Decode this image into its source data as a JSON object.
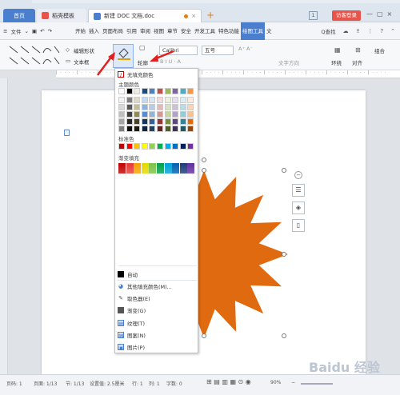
{
  "titlebar": {
    "tabs": [
      {
        "label": "首页"
      },
      {
        "label": "稻壳模板"
      },
      {
        "label": "新建 DOC 文档.doc"
      }
    ],
    "page_number_badge": "1",
    "login_label": "访客登录"
  },
  "menubar": {
    "file_label": "文件",
    "items": [
      "开始",
      "插入",
      "页面布局",
      "引用",
      "审阅",
      "视图",
      "章节",
      "安全",
      "开发工具",
      "特色功能",
      "绘图工具",
      "文"
    ],
    "search_label": "Q查找"
  },
  "ribbon": {
    "edit_shape_label": "编辑形状",
    "textbox_label": "文本框",
    "fill_label": "填充",
    "outline_label": "轮廓",
    "font_name": "Calibri",
    "font_size": "五号",
    "text_direction_label": "文字方向",
    "wrap_label": "环绕",
    "align_label": "对齐",
    "group_label": "组合"
  },
  "fill_menu": {
    "no_fill_label": "无填充颜色",
    "theme_colors_label": "主题颜色",
    "standard_colors_label": "标准色",
    "gradient_label": "渐变填充",
    "auto_label": "自动",
    "more_colors_label": "其他填充颜色(M)...",
    "eyedropper_label": "取色器(E)",
    "gradient_item_label": "渐变(G)",
    "texture_label": "纹理(T)",
    "pattern_label": "图案(N)",
    "picture_label": "图片(P)",
    "theme_top_row": [
      "#ffffff",
      "#000000",
      "#eeece1",
      "#1f497d",
      "#4f81bd",
      "#c0504d",
      "#9bbb59",
      "#8064a2",
      "#4bacc6",
      "#f79646"
    ],
    "theme_grid": [
      [
        "#f2f2f2",
        "#7f7f7f",
        "#ddd9c3",
        "#c6d9f0",
        "#dbe5f1",
        "#f2dcdb",
        "#ebf1dd",
        "#e5e0ec",
        "#dbeef3",
        "#fdeada"
      ],
      [
        "#d8d8d8",
        "#595959",
        "#c4bd97",
        "#8db3e2",
        "#b8cce4",
        "#e5b9b7",
        "#d7e3bc",
        "#ccc1d9",
        "#b7dde8",
        "#fbd5b5"
      ],
      [
        "#bfbfbf",
        "#3f3f3f",
        "#938953",
        "#548dd4",
        "#95b3d7",
        "#d99694",
        "#c3d69b",
        "#b2a2c7",
        "#92cddc",
        "#fac08f"
      ],
      [
        "#a5a5a5",
        "#262626",
        "#494429",
        "#17365d",
        "#366092",
        "#953734",
        "#76923c",
        "#5f497a",
        "#31859b",
        "#e36c09"
      ],
      [
        "#7f7f7f",
        "#0c0c0c",
        "#1d1b10",
        "#0f243e",
        "#244061",
        "#632423",
        "#4f6128",
        "#3f3151",
        "#205867",
        "#974806"
      ]
    ],
    "standard_colors": [
      "#c00000",
      "#ff0000",
      "#ffc000",
      "#ffff00",
      "#92d050",
      "#00b050",
      "#00b0f0",
      "#0070c0",
      "#002060",
      "#7030a0"
    ],
    "gradient_colors": [
      "#c00000",
      "#e53935",
      "#f4a300",
      "#e5d800",
      "#7cc245",
      "#00a04a",
      "#00a0d8",
      "#0060b0",
      "#1a3a7a",
      "#6030a0"
    ]
  },
  "status": {
    "page": "页码: 1",
    "pages": "页面: 1/13",
    "section": "节: 1/13",
    "setting": "设置值: 2.5厘米",
    "row": "行: 1",
    "col": "列: 1",
    "words": "字数: 0",
    "zoom": "90%"
  },
  "watermark": "Baidu 经验",
  "colors": {
    "accent": "#4a7fcf",
    "shape_fill": "#e06a10",
    "arrow": "#e02020"
  }
}
